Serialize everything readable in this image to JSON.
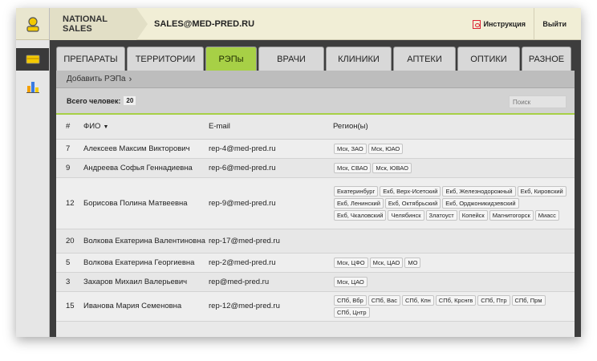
{
  "header": {
    "breadcrumb_root": "NATIONAL SALES",
    "breadcrumb_current": "SALES@MED-PRED.RU",
    "instruction_label": "Инструкция",
    "logout_label": "Выйти"
  },
  "tabs": [
    {
      "label": "ПРЕПАРАТЫ"
    },
    {
      "label": "ТЕРРИТОРИИ"
    },
    {
      "label": "РЭПы"
    },
    {
      "label": "ВРАЧИ"
    },
    {
      "label": "КЛИНИКИ"
    },
    {
      "label": "АПТЕКИ"
    },
    {
      "label": "ОПТИКИ"
    },
    {
      "label": "РАЗНОЕ"
    }
  ],
  "active_tab": "РЭПы",
  "subbar": {
    "add_label": "Добавить РЭПа"
  },
  "summary": {
    "total_label": "Всего человек:",
    "total_count": "20",
    "search_placeholder": "Поиск"
  },
  "table": {
    "headers": {
      "num": "#",
      "name": "ФИО",
      "email": "E-mail",
      "region": "Регион(ы)"
    },
    "rows": [
      {
        "num": "7",
        "name": "Алексеев Максим Викторович",
        "email": "rep-4@med-pred.ru",
        "regions": [
          "Мск, ЗАО",
          "Мск, ЮАО"
        ]
      },
      {
        "num": "9",
        "name": "Андреева Софья Геннадиевна",
        "email": "rep-6@med-pred.ru",
        "regions": [
          "Мск, СВАО",
          "Мск, ЮВАО"
        ]
      },
      {
        "num": "12",
        "name": "Борисова Полина Матвеевна",
        "email": "rep-9@med-pred.ru",
        "regions": [
          "Екатеринбург",
          "Екб, Верх-Исетский",
          "Екб, Железнодорожный",
          "Екб, Кировский",
          "Екб, Ленинский",
          "Екб, Октябрьский",
          "Екб, Орджоникидзевский",
          "Екб, Чкаловский",
          "Челябинск",
          "Златоуст",
          "Копейск",
          "Магнитогорск",
          "Миасс"
        ]
      },
      {
        "num": "20",
        "name": "Волкова Екатерина Валентиновна",
        "email": "rep-17@med-pred.ru",
        "regions": []
      },
      {
        "num": "5",
        "name": "Волкова Екатерина Георгиевна",
        "email": "rep-2@med-pred.ru",
        "regions": [
          "Мск, ЦФО",
          "Мск, ЦАО",
          "МО"
        ]
      },
      {
        "num": "3",
        "name": "Захаров Михаил Валерьевич",
        "email": "rep@med-pred.ru",
        "regions": [
          "Мск, ЦАО"
        ]
      },
      {
        "num": "15",
        "name": "Иванова Мария Семеновна",
        "email": "rep-12@med-pred.ru",
        "regions": [
          "СПб, Вбр",
          "СПб, Вас",
          "СПб, Кпн",
          "СПб, Крснгв",
          "СПб, Птр",
          "СПб, Прм",
          "СПб, Цнтр"
        ]
      }
    ]
  },
  "colors": {
    "accent_green": "#a7d046",
    "dark_bg": "#3d3d3d",
    "topbar_bg": "#f1eed6"
  }
}
